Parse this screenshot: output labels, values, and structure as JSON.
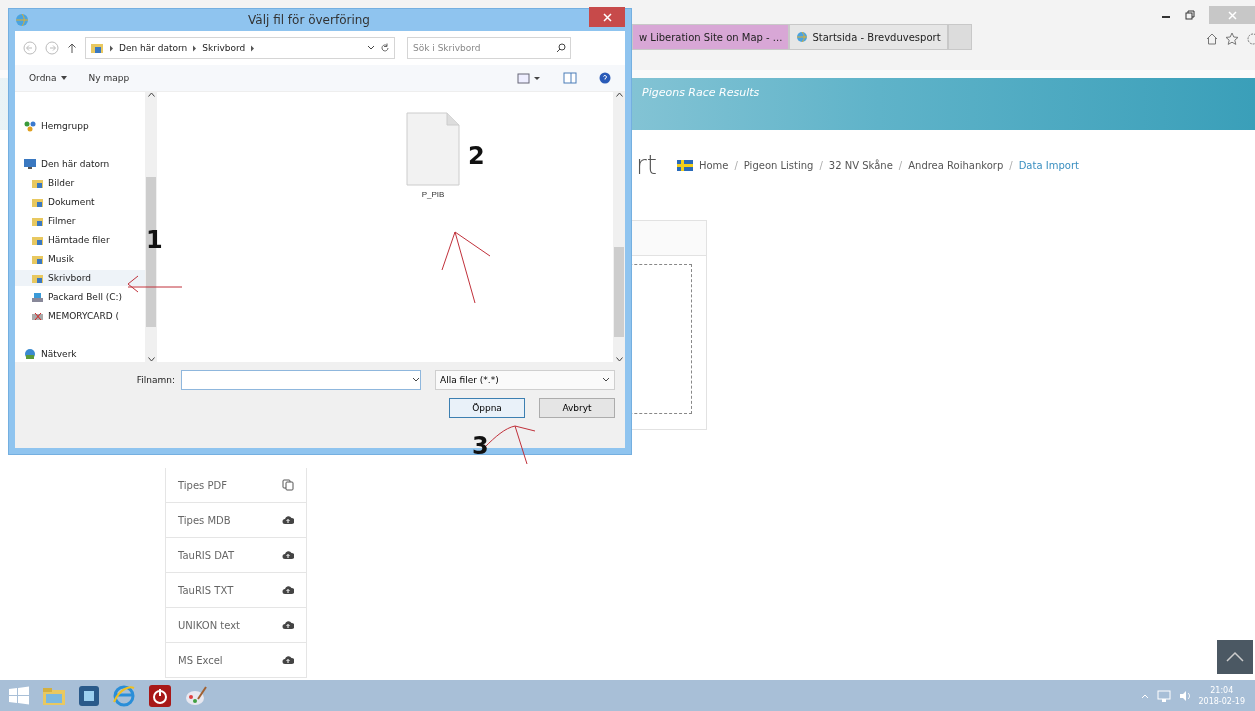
{
  "browser": {
    "tabs": [
      {
        "label": "w Liberation Site on Map - ...",
        "selected": false
      },
      {
        "label": "Startsida - Brevduvesport",
        "selected": true
      }
    ],
    "banner": {
      "title": "Pigeons Race Results"
    },
    "page": {
      "heading": "rt",
      "breadcrumb_separator": "/",
      "breadcrumb": [
        {
          "label": "Home",
          "current": false
        },
        {
          "label": "Pigeon Listing",
          "current": false
        },
        {
          "label": "32 NV Skåne",
          "current": false
        },
        {
          "label": "Andrea Roihankorp",
          "current": false
        },
        {
          "label": "Data Import",
          "current": true
        }
      ]
    },
    "formats": [
      {
        "label": "Tipes PDF",
        "kind": "copy"
      },
      {
        "label": "Tipes MDB",
        "kind": "upload"
      },
      {
        "label": "TauRIS DAT",
        "kind": "upload"
      },
      {
        "label": "TauRIS TXT",
        "kind": "upload"
      },
      {
        "label": "UNIKON text",
        "kind": "upload"
      },
      {
        "label": "MS Excel",
        "kind": "upload"
      }
    ]
  },
  "dialog": {
    "title": "Välj fil för överföring",
    "path": [
      "Den här datorn",
      "Skrivbord"
    ],
    "search": {
      "placeholder": "Sök i Skrivbord"
    },
    "toolbar": [
      "Ordna",
      "Ny mapp"
    ],
    "nav": [
      {
        "label": "Hemgrupp",
        "kind": "homegroup",
        "selected": false
      },
      {
        "label": "Den här datorn",
        "kind": "computer",
        "selected": false,
        "children": [
          {
            "label": "Bilder",
            "kind": "folder",
            "selected": false
          },
          {
            "label": "Dokument",
            "kind": "folder",
            "selected": false
          },
          {
            "label": "Filmer",
            "kind": "folder",
            "selected": false
          },
          {
            "label": "Hämtade filer",
            "kind": "folder",
            "selected": false
          },
          {
            "label": "Musik",
            "kind": "folder",
            "selected": false
          },
          {
            "label": "Skrivbord",
            "kind": "folder",
            "selected": true
          },
          {
            "label": "Packard Bell (C:)",
            "kind": "drive",
            "selected": false
          },
          {
            "label": "MEMORYCARD (",
            "kind": "card",
            "selected": false
          }
        ]
      },
      {
        "label": "Nätverk",
        "kind": "network",
        "selected": false
      }
    ],
    "files": [
      {
        "name": "P_PIB"
      }
    ],
    "filename": {
      "label": "Filnamn:"
    },
    "filter": "Alla filer (*.*)",
    "buttons": [
      {
        "label": "Öppna",
        "default": true
      },
      {
        "label": "Avbryt",
        "default": false
      }
    ]
  },
  "annotations": [
    "1",
    "2",
    "3"
  ],
  "taskbar": {
    "time": "21:04",
    "date": "2018-02-19"
  }
}
